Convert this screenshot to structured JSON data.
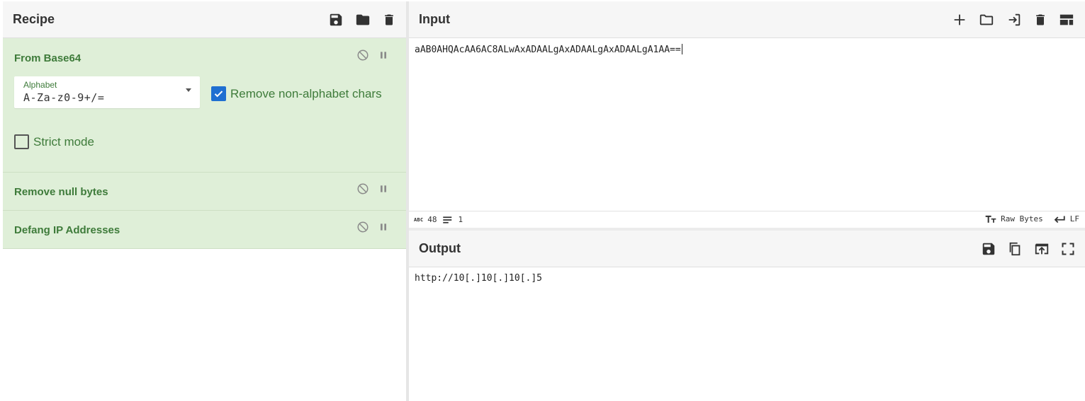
{
  "recipe": {
    "title": "Recipe",
    "operations": [
      {
        "title": "From Base64",
        "alphabet_label": "Alphabet",
        "alphabet_value": "A-Za-z0-9+/=",
        "remove_non_alphabet_label": "Remove non-alphabet chars",
        "remove_non_alphabet_checked": true,
        "strict_mode_label": "Strict mode",
        "strict_mode_checked": false
      },
      {
        "title": "Remove null bytes"
      },
      {
        "title": "Defang IP Addresses"
      }
    ]
  },
  "input": {
    "title": "Input",
    "value": "aAB0AHQAcAA6AC8ALwAxADAALgAxADAALgAxADAALgA1AA==",
    "status": {
      "char_count": "48",
      "line_count": "1",
      "encoding_label": "Raw Bytes",
      "eol_label": "LF"
    }
  },
  "output": {
    "title": "Output",
    "value": "http://10[.]10[.]10[.]5"
  },
  "colors": {
    "op_background": "#dfefd8",
    "op_text": "#3e7b3a",
    "checkbox_checked": "#1f6fd1"
  },
  "icons": {
    "recipe_header": [
      "save-icon",
      "folder-icon",
      "trash-icon"
    ],
    "input_header": [
      "plus-icon",
      "folder-icon",
      "import-icon",
      "trash-icon",
      "layout-icon"
    ],
    "output_header": [
      "save-icon",
      "copy-icon",
      "export-icon",
      "fullscreen-icon"
    ],
    "op_controls": [
      "disable-icon",
      "pause-icon"
    ]
  }
}
